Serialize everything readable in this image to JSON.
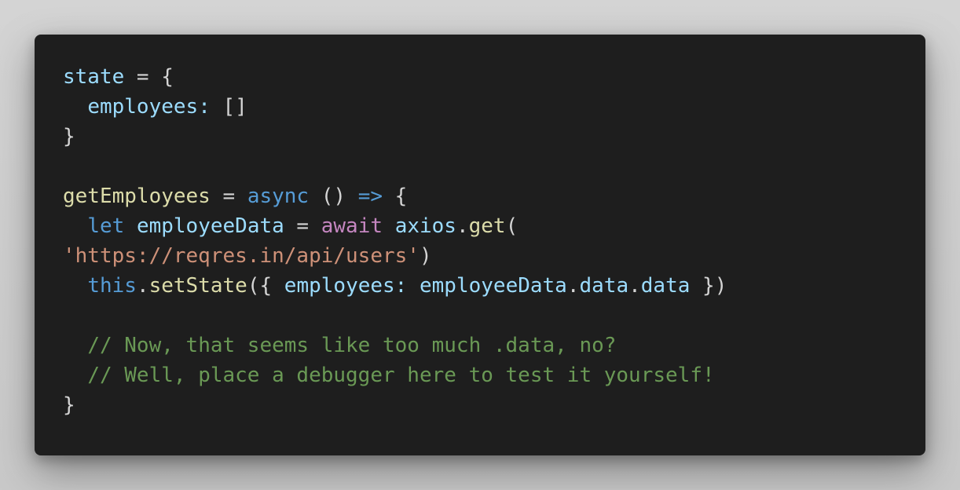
{
  "colors": {
    "background": "#1e1e1e",
    "variable": "#9cdcfe",
    "function": "#dcdcaa",
    "keyword": "#569cd6",
    "control": "#c586c0",
    "string": "#ce9178",
    "comment": "#6a9955",
    "punctuation": "#d4d4d4"
  },
  "code": {
    "l1": {
      "state": "state",
      "p1": " = {"
    },
    "l2": {
      "indent": "  ",
      "employees": "employees:",
      "p1": " []"
    },
    "l3": {
      "p1": "}"
    },
    "l5": {
      "fn": "getEmployees",
      "p1": " = ",
      "async": "async",
      "p2": " () ",
      "arrow": "=>",
      "p3": " {"
    },
    "l6": {
      "indent": "  ",
      "let": "let",
      "p1": " ",
      "employeeData": "employeeData",
      "p2": " = ",
      "await": "await",
      "p3": " ",
      "axios": "axios",
      "p4": ".",
      "get": "get",
      "p5": "("
    },
    "l7": {
      "url": "'https://reqres.in/api/users'",
      "p1": ")"
    },
    "l8": {
      "indent": "  ",
      "this": "this",
      "p1": ".",
      "setState": "setState",
      "p2": "({ ",
      "employees": "employees:",
      "p3": " ",
      "employeeData": "employeeData",
      "p4": ".",
      "data1": "data",
      "p5": ".",
      "data2": "data",
      "p6": " })"
    },
    "l10": {
      "indent": "  ",
      "comment": "// Now, that seems like too much .data, no?"
    },
    "l11": {
      "indent": "  ",
      "comment": "// Well, place a debugger here to test it yourself!"
    },
    "l12": {
      "p1": "}"
    }
  }
}
